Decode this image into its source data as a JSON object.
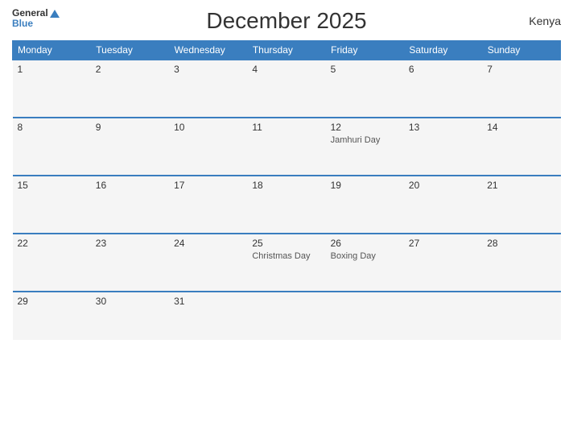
{
  "header": {
    "title": "December 2025",
    "country": "Kenya"
  },
  "logo": {
    "line1": "General",
    "line2": "Blue"
  },
  "weekdays": [
    "Monday",
    "Tuesday",
    "Wednesday",
    "Thursday",
    "Friday",
    "Saturday",
    "Sunday"
  ],
  "weeks": [
    [
      {
        "day": "1",
        "event": ""
      },
      {
        "day": "2",
        "event": ""
      },
      {
        "day": "3",
        "event": ""
      },
      {
        "day": "4",
        "event": ""
      },
      {
        "day": "5",
        "event": ""
      },
      {
        "day": "6",
        "event": ""
      },
      {
        "day": "7",
        "event": ""
      }
    ],
    [
      {
        "day": "8",
        "event": ""
      },
      {
        "day": "9",
        "event": ""
      },
      {
        "day": "10",
        "event": ""
      },
      {
        "day": "11",
        "event": ""
      },
      {
        "day": "12",
        "event": "Jamhuri Day"
      },
      {
        "day": "13",
        "event": ""
      },
      {
        "day": "14",
        "event": ""
      }
    ],
    [
      {
        "day": "15",
        "event": ""
      },
      {
        "day": "16",
        "event": ""
      },
      {
        "day": "17",
        "event": ""
      },
      {
        "day": "18",
        "event": ""
      },
      {
        "day": "19",
        "event": ""
      },
      {
        "day": "20",
        "event": ""
      },
      {
        "day": "21",
        "event": ""
      }
    ],
    [
      {
        "day": "22",
        "event": ""
      },
      {
        "day": "23",
        "event": ""
      },
      {
        "day": "24",
        "event": ""
      },
      {
        "day": "25",
        "event": "Christmas Day"
      },
      {
        "day": "26",
        "event": "Boxing Day"
      },
      {
        "day": "27",
        "event": ""
      },
      {
        "day": "28",
        "event": ""
      }
    ],
    [
      {
        "day": "29",
        "event": ""
      },
      {
        "day": "30",
        "event": ""
      },
      {
        "day": "31",
        "event": ""
      },
      {
        "day": "",
        "event": ""
      },
      {
        "day": "",
        "event": ""
      },
      {
        "day": "",
        "event": ""
      },
      {
        "day": "",
        "event": ""
      }
    ]
  ]
}
